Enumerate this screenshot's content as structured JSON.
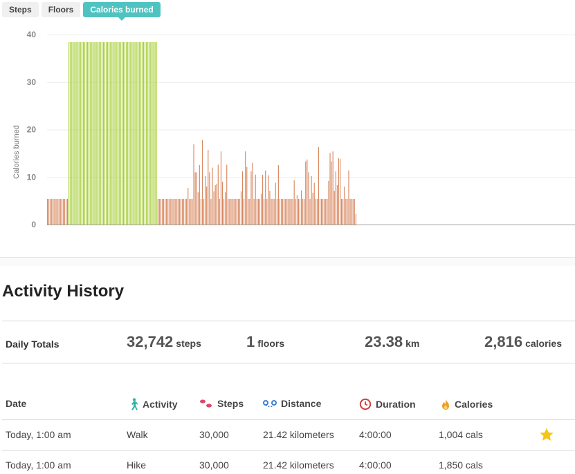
{
  "tabs": [
    "Steps",
    "Floors",
    "Calories burned"
  ],
  "active_tab": 2,
  "chart_data": {
    "type": "bar",
    "ylabel": "Calories burned",
    "ylim": [
      0,
      40
    ],
    "yticks": [
      0,
      10,
      20,
      30,
      40
    ],
    "grid": true,
    "x": [
      0,
      1,
      2,
      3,
      4,
      5,
      6,
      7,
      8,
      9,
      10,
      11,
      12,
      13,
      14,
      15,
      16,
      17,
      18,
      19,
      20,
      21,
      22,
      23,
      24,
      25,
      26,
      27,
      28,
      29,
      30,
      31,
      32,
      33,
      34,
      35,
      36,
      37,
      38,
      39,
      40,
      41,
      42,
      43,
      44,
      45,
      46,
      47,
      48,
      49,
      50,
      51,
      52,
      53,
      54,
      55,
      56,
      57,
      58,
      59,
      60,
      61,
      62,
      63,
      64,
      65,
      66,
      67,
      68,
      69,
      70,
      71,
      72,
      73,
      74,
      75,
      76,
      77,
      78,
      79,
      80,
      81,
      82,
      83,
      84,
      85,
      86,
      87,
      88,
      89,
      90,
      91,
      92,
      93,
      94,
      95,
      96,
      97,
      98,
      99,
      100,
      101,
      102,
      103,
      104,
      105,
      106,
      107,
      108,
      109,
      110,
      111,
      112,
      113,
      114,
      115,
      116,
      117,
      118,
      119,
      120,
      121,
      122,
      123,
      124,
      125,
      126,
      127,
      128,
      129,
      130,
      131,
      132,
      133,
      134,
      135,
      136,
      137,
      138,
      139,
      140,
      141,
      142,
      143,
      144,
      145,
      146,
      147,
      148,
      149,
      150,
      151,
      152,
      153,
      154,
      155,
      156,
      157,
      158,
      159,
      160,
      161,
      162,
      163,
      164,
      165,
      166,
      167,
      168,
      169,
      170,
      171,
      172,
      173,
      174,
      175,
      176,
      177,
      178,
      179,
      180,
      181,
      182,
      183,
      184,
      185,
      186,
      187,
      188,
      189,
      190,
      191,
      192,
      193,
      194,
      195,
      196,
      197,
      198,
      199,
      200,
      201,
      202,
      203,
      204,
      205,
      206,
      207,
      208,
      209,
      210,
      211,
      212,
      213,
      214,
      215,
      216,
      217,
      218,
      219,
      220,
      221,
      222,
      223,
      224,
      225,
      226,
      227,
      228,
      229,
      230,
      231,
      232,
      233,
      234,
      235,
      236,
      237,
      238,
      239,
      240,
      241,
      242,
      243,
      244,
      245,
      246,
      247,
      248,
      249,
      250,
      251,
      252,
      253,
      254,
      255,
      256,
      257,
      258,
      259,
      260,
      261,
      262,
      263,
      264,
      265,
      266,
      267,
      268,
      269,
      270,
      271,
      272,
      273,
      274,
      275,
      276,
      277,
      278,
      279,
      280,
      281,
      282,
      283,
      284,
      285,
      286,
      287,
      288,
      289,
      290,
      291,
      292,
      293,
      294,
      295,
      296,
      297,
      298,
      299,
      300,
      301,
      302,
      303,
      304,
      305,
      306,
      307,
      308,
      309,
      310,
      311,
      312,
      313,
      314,
      315,
      316,
      317,
      318,
      319,
      320,
      321,
      322,
      323,
      324,
      325,
      326,
      327,
      328,
      329,
      330,
      331,
      332,
      333,
      334,
      335,
      336,
      337,
      338,
      339,
      340,
      341,
      342,
      343,
      344,
      345,
      346,
      347,
      348,
      349,
      350,
      351,
      352,
      353,
      354,
      355,
      356,
      357,
      358,
      359,
      360,
      361,
      362,
      363,
      364,
      365,
      366,
      367,
      368,
      369,
      370,
      371,
      372,
      373,
      374,
      375,
      376,
      377,
      378,
      379
    ],
    "values": [
      5.4,
      5.4,
      5.4,
      5.4,
      5.4,
      5.4,
      5.4,
      5.4,
      5.4,
      5.4,
      5.4,
      5.4,
      5.4,
      5.4,
      5.4,
      38.4,
      38.4,
      38.4,
      38.4,
      38.4,
      38.4,
      38.4,
      38.4,
      38.4,
      38.4,
      38.4,
      38.4,
      38.4,
      38.4,
      38.4,
      38.4,
      38.4,
      38.4,
      38.4,
      38.4,
      38.4,
      38.4,
      38.4,
      38.4,
      38.4,
      38.4,
      38.4,
      38.4,
      38.4,
      38.4,
      38.4,
      38.4,
      38.4,
      38.4,
      38.4,
      38.4,
      38.4,
      38.4,
      38.4,
      38.4,
      38.4,
      38.4,
      38.4,
      38.4,
      38.4,
      38.4,
      38.4,
      38.4,
      38.4,
      38.4,
      38.4,
      38.4,
      38.4,
      38.4,
      38.4,
      38.4,
      38.4,
      38.4,
      38.4,
      38.4,
      38.4,
      38.4,
      5.4,
      5.4,
      5.4,
      5.4,
      5.4,
      5.4,
      5.4,
      5.4,
      5.4,
      5.4,
      5.4,
      5.4,
      5.4,
      5.4,
      5.4,
      5.4,
      5.4,
      5.4,
      5.4,
      5.4,
      5.4,
      7.7,
      5.4,
      5.4,
      5.4,
      16.9,
      11,
      11,
      6.8,
      12.5,
      5.4,
      17.8,
      5.4,
      10.2,
      8,
      15.7,
      11,
      5.4,
      12,
      7,
      8.3,
      8.6,
      12.6,
      5.4,
      15.4,
      9,
      5.4,
      6.8,
      12.6,
      5.4,
      5.4,
      5.4,
      5.4,
      5.4,
      5.4,
      5.4,
      5.4,
      5.4,
      7,
      11.2,
      5.4,
      15.4,
      12.1,
      5.4,
      5.4,
      11.2,
      13,
      5.4,
      10.5,
      5.4,
      5.4,
      5.4,
      6.5,
      10.5,
      5.4,
      11.4,
      5.4,
      10.4,
      7.1,
      5.4,
      5.4,
      5.4,
      8.8,
      5.4,
      12.5,
      5.4,
      5.4,
      5.4,
      5.4,
      5.4,
      5.4,
      5.4,
      5.4,
      5.4,
      5.4,
      9.3,
      5.4,
      6.2,
      5.4,
      5.4,
      7.2,
      5.4,
      5.4,
      13.3,
      13.7,
      11,
      5.4,
      10.2,
      6.7,
      8.8,
      5.4,
      5.4,
      16.3,
      5.4,
      5.4,
      5.4,
      5.4,
      5.4,
      5.4,
      9.2,
      15.1,
      13.3,
      15.4,
      7.1,
      11.2,
      8.3,
      14,
      13.8,
      5.4,
      5.4,
      8,
      5.4,
      5.4,
      11.4,
      5.4,
      5.4,
      5.4,
      5.4,
      2.2,
      0,
      0,
      0,
      0,
      0,
      0,
      0,
      0,
      0,
      0,
      0,
      0,
      0,
      0,
      0,
      0,
      0,
      0,
      0,
      0,
      0,
      0,
      0,
      0,
      0,
      0,
      0,
      0,
      0,
      0,
      0,
      0,
      0,
      0,
      0,
      0,
      0,
      0,
      0,
      0,
      0,
      0,
      0,
      0,
      0,
      0,
      0,
      0,
      0,
      0,
      0,
      0,
      0,
      0,
      0,
      0,
      0,
      0,
      0,
      0,
      0,
      0,
      0,
      0,
      0,
      0,
      0,
      0,
      0,
      0,
      0,
      0,
      0,
      0,
      0,
      0,
      0,
      0,
      0,
      0,
      0,
      0,
      0,
      0,
      0,
      0,
      0,
      0,
      0,
      0,
      0,
      0,
      0,
      0,
      0,
      0,
      0,
      0,
      0,
      0,
      0,
      0,
      0,
      0,
      0,
      0,
      0,
      0,
      0,
      0,
      0,
      0,
      0,
      0,
      0,
      0,
      0,
      0,
      0,
      0,
      0,
      0,
      0,
      0,
      0,
      0,
      0,
      0,
      0,
      0,
      0,
      0,
      0,
      0,
      0,
      0,
      0,
      0,
      0,
      0,
      0,
      0,
      0,
      0,
      0,
      0,
      0,
      0,
      0,
      0,
      0,
      0
    ],
    "colors": {
      "low": "#d8875f",
      "peak": "#e9c23a",
      "active": "#a8cf39",
      "axis": "#999999"
    }
  },
  "section_title": "Activity History",
  "daily_totals": {
    "label": "Daily Totals",
    "steps": {
      "value": "32,742",
      "unit": "steps"
    },
    "floors": {
      "value": "1",
      "unit": "floors"
    },
    "distance": {
      "value": "23.38",
      "unit": "km"
    },
    "calories": {
      "value": "2,816",
      "unit": "calories"
    }
  },
  "table": {
    "headers": {
      "date": "Date",
      "activity": "Activity",
      "steps": "Steps",
      "distance": "Distance",
      "duration": "Duration",
      "calories": "Calories"
    },
    "icons": {
      "activity": "walking-person-icon",
      "steps": "footprints-icon",
      "distance": "route-icon",
      "duration": "clock-icon",
      "calories": "flame-icon"
    },
    "rows": [
      {
        "date": "Today, 1:00 am",
        "activity": "Walk",
        "steps": "30,000",
        "distance": "21.42 kilometers",
        "duration": "4:00:00",
        "calories": "1,004 cals",
        "starred": true
      },
      {
        "date": "Today, 1:00 am",
        "activity": "Hike",
        "steps": "30,000",
        "distance": "21.42 kilometers",
        "duration": "4:00:00",
        "calories": "1,850 cals",
        "starred": false
      }
    ]
  }
}
